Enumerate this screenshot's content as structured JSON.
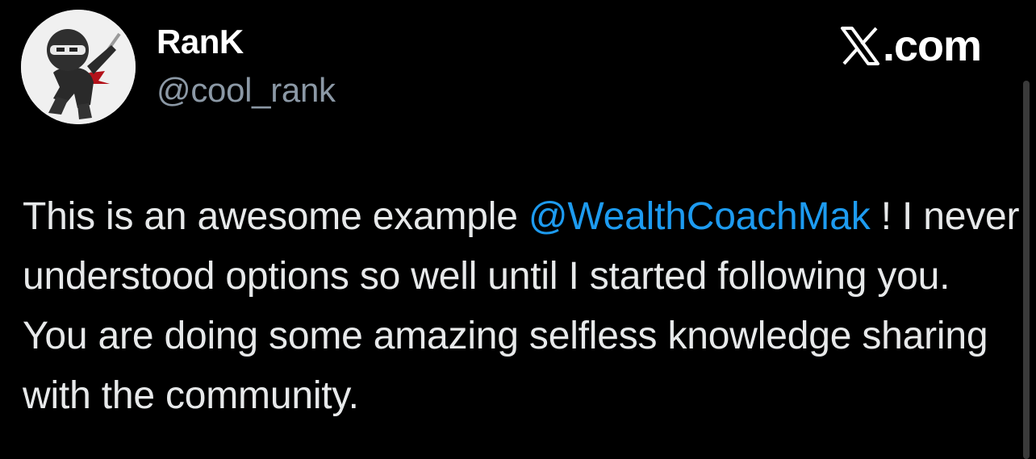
{
  "author": {
    "display_name": "RanK",
    "handle": "@cool_rank",
    "avatar_icon": "ninja-avatar-icon"
  },
  "brand": {
    "label": ".com",
    "icon": "x-logo-icon"
  },
  "tweet": {
    "text_before_mention": "This is an awesome example ",
    "mention": "@WealthCoachMak",
    "text_after_mention": " ! I never understood options so well until I started following you. You are doing some amazing selfless knowledge sharing with the community.",
    "mention_color": "#1d9bf0"
  },
  "colors": {
    "background": "#000000",
    "text": "#e7e9ea",
    "secondary_text": "#8b98a5",
    "accent": "#1d9bf0"
  }
}
